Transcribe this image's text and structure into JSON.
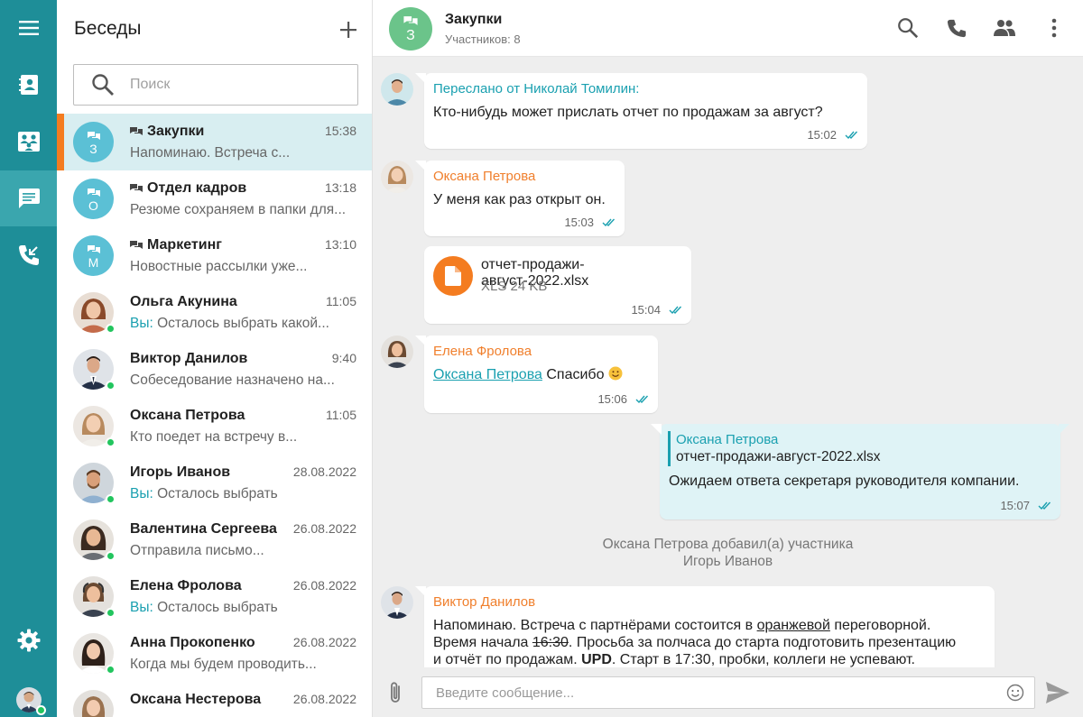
{
  "nav": {
    "items": [
      {
        "name": "menu",
        "icon": "hamburger-icon"
      },
      {
        "name": "contacts",
        "icon": "contacts-book-icon"
      },
      {
        "name": "directory",
        "icon": "org-directory-icon"
      },
      {
        "name": "chats",
        "icon": "chat-bubble-icon",
        "active": true
      },
      {
        "name": "calls",
        "icon": "call-history-icon"
      },
      {
        "name": "settings",
        "icon": "gear-icon"
      }
    ]
  },
  "sidebar": {
    "title": "Беседы",
    "search_placeholder": "Поиск",
    "conversations": [
      {
        "name": "Закупки",
        "time": "15:38",
        "preview": "Напоминаю. Встреча с...",
        "group": true,
        "letter": "З",
        "active": true
      },
      {
        "name": "Отдел кадров",
        "time": "13:18",
        "preview": "Резюме сохраняем в папки для...",
        "group": true,
        "letter": "О"
      },
      {
        "name": "Маркетинг",
        "time": "13:10",
        "preview": "Новостные рассылки уже...",
        "group": true,
        "letter": "М"
      },
      {
        "name": "Ольга Акунина",
        "time": "11:05",
        "you": "Вы:",
        "preview": " Осталось выбрать какой...",
        "online": true
      },
      {
        "name": "Виктор Данилов",
        "time": "9:40",
        "preview": "Собеседование назначено на...",
        "online": true
      },
      {
        "name": "Оксана Петрова",
        "time": "11:05",
        "preview": "Кто поедет на встречу в...",
        "online": true
      },
      {
        "name": "Игорь Иванов",
        "time": "28.08.2022",
        "you": "Вы:",
        "preview": " Осталось выбрать",
        "online": true
      },
      {
        "name": "Валентина Сергеева",
        "time": "26.08.2022",
        "preview": "Отправила письмо...",
        "online": true
      },
      {
        "name": "Елена Фролова",
        "time": "26.08.2022",
        "you": "Вы:",
        "preview": " Осталось выбрать",
        "online": true
      },
      {
        "name": "Анна Прокопенко",
        "time": "26.08.2022",
        "preview": "Когда мы будем проводить...",
        "online": true
      },
      {
        "name": "Оксана Нестерова",
        "time": "26.08.2022",
        "preview": "",
        "online": false
      }
    ]
  },
  "header": {
    "letter": "З",
    "title": "Закупки",
    "subtitle": "Участников: 8"
  },
  "messages": {
    "m1": {
      "author": "Переслано от Николай Томилин:",
      "text": "Кто-нибудь может прислать отчет по продажам за август?",
      "time": "15:02"
    },
    "m2": {
      "author": "Оксана Петрова",
      "text": "У меня как раз открыт он.",
      "time": "15:03"
    },
    "m3": {
      "file_name": "отчет-продажи-август-2022.xlsx",
      "file_size": "XLS 24 KB",
      "time": "15:04"
    },
    "m4": {
      "author": "Елена Фролова",
      "mention": "Оксана Петрова",
      "text": " Спасибо ",
      "time": "15:06"
    },
    "m5": {
      "quote_author": "Оксана Петрова",
      "quote_text": "отчет-продажи-август-2022.xlsx",
      "text": "Ожидаем ответа секретаря руководителя компании.",
      "time": "15:07"
    },
    "sys": {
      "line1": "Оксана Петрова добавил(а) участника",
      "line2": "Игорь Иванов"
    },
    "m6": {
      "author": "Виктор Данилов",
      "l1a": "Напоминаю. Встреча с партнёрами состоится в ",
      "l1b": "оранжевой",
      "l1c": " переговорной.",
      "l2a": "Время начала ",
      "l2b": "16:30",
      "l2c": ". Просьба за полчаса до старта подготовить презентацию",
      "l3a": "и отчёт по продажам. ",
      "l3b": "UPD",
      "l3c": ". Старт в 17:30, пробки, коллеги не успевают."
    }
  },
  "composer": {
    "placeholder": "Введите сообщение..."
  },
  "colors": {
    "rail": "#1e8e98",
    "accent": "#1aa0b0",
    "orange": "#f47c20",
    "online": "#22c55e"
  }
}
